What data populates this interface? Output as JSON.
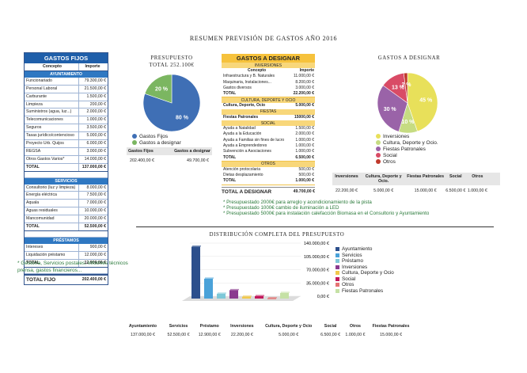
{
  "title": "RESUMEN PREVISIÓN DE GASTOS AÑO 2016",
  "fixed": {
    "header": "GASTOS FIJOS",
    "col_concept": "Concepto",
    "col_amount": "Importe",
    "sections": [
      {
        "name": "AYUNTAMIENTO",
        "rows": [
          [
            "Funcionariado",
            "79.300,00 €"
          ],
          [
            "Personal Laboral",
            "21.500,00 €"
          ],
          [
            "Carburante",
            "1.500,00 €"
          ],
          [
            "Limpieza",
            "200,00 €"
          ],
          [
            "Suministros (agua, luz...)",
            "2.000,00 €"
          ],
          [
            "Telecomunicaciones",
            "1.000,00 €"
          ],
          [
            "Seguros",
            "3.500,00 €"
          ],
          [
            "Tasas jurídico/contencioso",
            "5.000,00 €"
          ],
          [
            "Proyecto Urb. Quijos",
            "6.000,00 €"
          ],
          [
            "REGSA",
            "3.000,00 €"
          ],
          [
            "Otros Gastos Varios*",
            "14.000,00 €"
          ]
        ],
        "total_label": "TOTAL",
        "total": "137.000,00 €"
      },
      {
        "name": "SERVICIOS",
        "rows": [
          [
            "Consultorio (luz y limpieza)",
            "8.000,00 €"
          ],
          [
            "Energía eléctrica",
            "7.500,00 €"
          ],
          [
            "Aquala",
            "7.000,00 €"
          ],
          [
            "Aguas residuales",
            "10.000,00 €"
          ],
          [
            "Mancomunidad",
            "20.000,00 €"
          ]
        ],
        "total_label": "TOTAL",
        "total": "52.500,00 €"
      },
      {
        "name": "PRÉSTAMOS",
        "rows": [
          [
            "Intereses",
            "900,00 €"
          ],
          [
            "Liquidación préstamo",
            "12.000,00 €"
          ]
        ],
        "total_label": "TOTAL",
        "total": "12.900,00 €"
      }
    ],
    "grand_label": "TOTAL FIJO",
    "grand_total": "202.400,00 €"
  },
  "footnote": "* Gestoría, Servicios postales, Informes técnicos prensa, gastos financieros...",
  "presupuesto": {
    "title": "PRESUPUESTO",
    "total_line": "TOTAL  252.100€",
    "legend": [
      "Gastos Fijos",
      "Gastos a designar"
    ],
    "labels": [
      "80 %",
      "20 %"
    ],
    "table_headers": [
      "Gastos Fijos",
      "Gastos a designar"
    ],
    "table_values": [
      "202.400,00 €",
      "49.700,00 €"
    ]
  },
  "designar": {
    "header": "GASTOS A DESIGNAR",
    "col_concept": "Concepto",
    "col_amount": "Importe",
    "sections": [
      {
        "name": "INVERSIONES",
        "rows": [
          [
            "Infraestructura y B. Naturales",
            "11.000,00 €"
          ],
          [
            "Maquinaria, Instalaciones...",
            "8.200,00 €"
          ],
          [
            "Gastos diversos",
            "3.000,00 €"
          ]
        ],
        "total_label": "TOTAL",
        "total": "22.200,00 €"
      },
      {
        "name": "CULTURA, DEPORTE Y OCIO",
        "rows": [
          [
            "Cultura, Deporte, Ocio",
            "5.000,00 €"
          ]
        ]
      },
      {
        "name": "FIESTAS",
        "rows": [
          [
            "Fiestas Patronales",
            "15000,00 €"
          ]
        ]
      },
      {
        "name": "SOCIAL",
        "rows": [
          [
            "Ayuda a Natalidad",
            "1.500,00 €"
          ],
          [
            "Ayuda a la Educación",
            "2.000,00 €"
          ],
          [
            "Ayuda a Familias sin fines de lucro",
            "1.000,00 €"
          ],
          [
            "Ayuda a Emprendedores",
            "1.000,00 €"
          ],
          [
            "Subvención a Asociaciones",
            "1.000,00 €"
          ]
        ],
        "total_label": "TOTAL",
        "total": "6.500,00 €"
      },
      {
        "name": "OTROS",
        "rows": [
          [
            "Atención protocolaria",
            "500,00 €"
          ],
          [
            "Dietas desplazamiento",
            "500,00 €"
          ]
        ],
        "total_label": "TOTAL",
        "total": "1.000,00 €"
      }
    ],
    "grand_label": "TOTAL A DESIGNAR",
    "grand_total": "49.700,00 €"
  },
  "designar_chart": {
    "title": "GASTOS A DESIGNAR",
    "legend": [
      "Inversiones",
      "Cultura, Deporte y Ocio.",
      "Fiestas Patronales",
      "Social",
      "Otros"
    ],
    "labels": [
      "45 %",
      "10 %",
      "30 %",
      "13 %",
      "2 %"
    ],
    "table_headers": [
      "Inversiones",
      "Cultura, Deporte y Ocio.",
      "Fiestas Patronales",
      "Social",
      "Otros"
    ],
    "table_values": [
      "22.200,00 €",
      "5.000,00 €",
      "15.000,00 €",
      "6.500,00 €",
      "1.000,00 €"
    ]
  },
  "notes": [
    "* Presupuestado 2000€ para arreglo y acondicionamiento de la pista",
    "* Presupuestado 1000€ cambio de iluminación a LED",
    "* Presupuestado 5000€ para instalación calefacción Biomasa en el Consultorio y Ayuntamiento"
  ],
  "distribution": {
    "title": "DISTRIBUCIÓN COMPLETA DEL PRESUPUESTO",
    "legend": [
      "Ayuntamiento",
      "Servicios",
      "Préstamo",
      "Inversiones",
      "Cultura, Deporte y Ocio",
      "Social",
      "Otros",
      "Fiestas Patronales"
    ],
    "table_headers": [
      "Ayuntamiento",
      "Servicios",
      "Préstamo",
      "Inversiones",
      "Cultura, Deporte y Ocio",
      "Social",
      "Otros",
      "Fiestas Patronales"
    ],
    "table_values": [
      "137.000,00 €",
      "52.500,00 €",
      "12.900,00 €",
      "22.200,00 €",
      "5.000,00 €",
      "6.500,00 €",
      "1.000,00 €",
      "15.000,00 €"
    ]
  },
  "colors": {
    "fixed": "#3f6fb5",
    "designar": "#7bb661",
    "inversiones": "#e8e05a",
    "cultura": "#c6dc82",
    "fiestas": "#9a63a8",
    "social": "#d94b66",
    "otros": "#c0392b",
    "ayuntamiento": "#2c4f8c",
    "servicios": "#4aa2d9",
    "prestamo": "#7ec8d8",
    "dist_inversiones": "#8a3a8f",
    "dist_cultura": "#f2c94c",
    "dist_social": "#c2185b",
    "dist_otros": "#e57373",
    "dist_fiestas": "#c5e1a5"
  },
  "chart_data": [
    {
      "type": "pie",
      "title": "PRESUPUESTO",
      "categories": [
        "Gastos Fijos",
        "Gastos a designar"
      ],
      "values": [
        202400,
        49700
      ]
    },
    {
      "type": "pie",
      "title": "GASTOS A DESIGNAR",
      "categories": [
        "Inversiones",
        "Cultura, Deporte y Ocio.",
        "Fiestas Patronales",
        "Social",
        "Otros"
      ],
      "values": [
        22200,
        5000,
        15000,
        6500,
        1000
      ]
    },
    {
      "type": "bar",
      "title": "DISTRIBUCIÓN COMPLETA DEL PRESUPUESTO",
      "categories": [
        "Ayuntamiento",
        "Servicios",
        "Préstamo",
        "Inversiones",
        "Cultura, Deporte y Ocio",
        "Social",
        "Otros",
        "Fiestas Patronales"
      ],
      "values": [
        137000,
        52500,
        12900,
        22200,
        5000,
        6500,
        1000,
        15000
      ],
      "yticks": [
        "0,00 €",
        "35.000,00 €",
        "70.000,00 €",
        "105.000,00 €",
        "140.000,00 €"
      ],
      "ylim": [
        0,
        140000
      ]
    }
  ]
}
